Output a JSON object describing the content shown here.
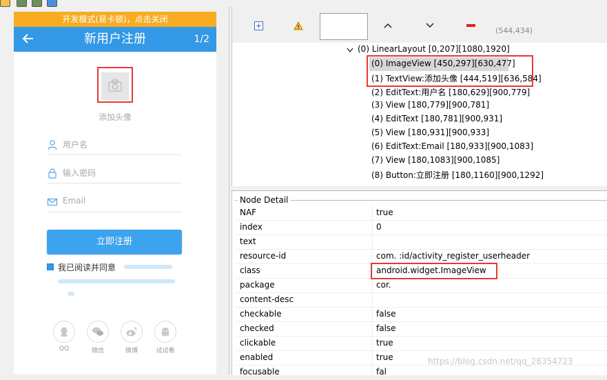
{
  "device": {
    "dev_banner": "开发模式(易卡顿)，点击关闭",
    "title": "新用户注册",
    "page": "1/2",
    "avatar_label": "添加头像",
    "username_placeholder": "用户名",
    "password_placeholder": "输入密码",
    "email_placeholder": "Email",
    "register_button": "立即注册",
    "agree_text": "我已阅读并同意",
    "social": [
      {
        "label": "QQ"
      },
      {
        "label": "微信"
      },
      {
        "label": "微博"
      },
      {
        "label": "试试看"
      }
    ],
    "colors": {
      "banner": "#f7ac22",
      "appbar": "#3398e6",
      "button": "#3ea3ef",
      "highlight": "#e53935"
    }
  },
  "toolbar": {
    "coords": "(544,434)"
  },
  "tree": {
    "root": "(0) LinearLayout [0,207][1080,1920]",
    "children": [
      "(0) ImageView [450,297][630,477]",
      "(1) TextView:添加头像 [444,519][636,584]",
      "(2) EditText:用户名 [180,629][900,779]",
      "(3) View [180,779][900,781]",
      "(4) EditText [180,781][900,931]",
      "(5) View [180,931][900,933]",
      "(6) EditText:Email [180,933][900,1083]",
      "(7) View [180,1083][900,1085]",
      "(8) Button:立即注册 [180,1160][900,1292]"
    ]
  },
  "detail": {
    "title": "Node Detail",
    "rows": [
      {
        "key": "NAF",
        "value": "true"
      },
      {
        "key": "index",
        "value": "0"
      },
      {
        "key": "text",
        "value": ""
      },
      {
        "key": "resource-id",
        "value": "com.           :id/activity_register_userheader"
      },
      {
        "key": "class",
        "value": "android.widget.ImageView"
      },
      {
        "key": "package",
        "value": "cor."
      },
      {
        "key": "content-desc",
        "value": ""
      },
      {
        "key": "checkable",
        "value": "false"
      },
      {
        "key": "checked",
        "value": "false"
      },
      {
        "key": "clickable",
        "value": "true"
      },
      {
        "key": "enabled",
        "value": "true"
      },
      {
        "key": "focusable",
        "value": "fal"
      }
    ],
    "watermark": "https://blog.csdn.net/qq_28354723"
  }
}
